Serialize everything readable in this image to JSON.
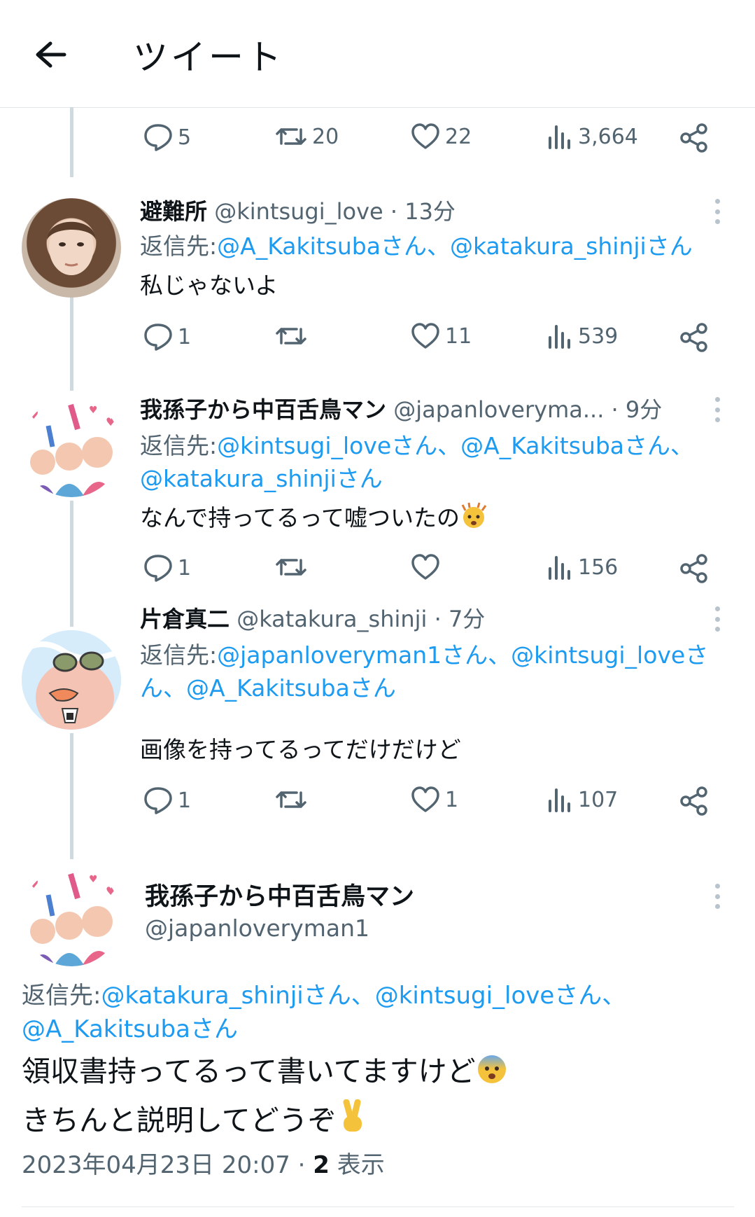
{
  "header": {
    "title": "ツイート"
  },
  "top_actions": {
    "reply": "5",
    "retweet": "20",
    "like": "22",
    "views": "3,664"
  },
  "tweets": [
    {
      "name": "避難所",
      "handle": "@kintsugi_love",
      "time": "· 13分",
      "reply_prefix": "返信先:",
      "mentions_line1": "@A_Kakitsubaさん、@katakura_shinjiさん",
      "mentions_line2": "",
      "text": "私じゃないよ",
      "reply": "1",
      "retweet": "",
      "like": "11",
      "views": "539"
    },
    {
      "name": "我孫子から中百舌鳥マン",
      "handle": "@japanloveryma...",
      "time": "· 9分",
      "reply_prefix": "返信先:",
      "mentions_line1": "@kintsugi_loveさん、@A_Kakitsubaさん、",
      "mentions_line2": "@katakura_shinjiさん",
      "text": "なんで持ってるって嘘ついたの",
      "reply": "1",
      "retweet": "",
      "like": "",
      "views": "156"
    },
    {
      "name": "片倉真二",
      "handle": "@katakura_shinji",
      "time": "· 7分",
      "reply_prefix": "返信先:",
      "mentions_line1": "@japanloveryman1さん、@kintsugi_loveさ",
      "mentions_line2": "ん、@A_Kakitsubaさん",
      "text": "画像を持ってるってだけだけど",
      "reply": "1",
      "retweet": "",
      "like": "1",
      "views": "107"
    }
  ],
  "main_tweet": {
    "name": "我孫子から中百舌鳥マン",
    "handle": "@japanloveryman1",
    "reply_prefix": "返信先:",
    "mentions_line1": "@katakura_shinjiさん、@kintsugi_loveさん、",
    "mentions_line2": "@A_Kakitsubaさん",
    "text_line1": "領収書持ってるって書いてますけど",
    "text_line2": "きちんと説明してどうぞ",
    "datetime": "2023年04月23日 20:07 · ",
    "views_count": "2",
    "views_label": " 表示"
  },
  "colors": {
    "accent": "#1d9bf0",
    "secondary_text": "#536471",
    "thread_line": "#cfd9de"
  }
}
